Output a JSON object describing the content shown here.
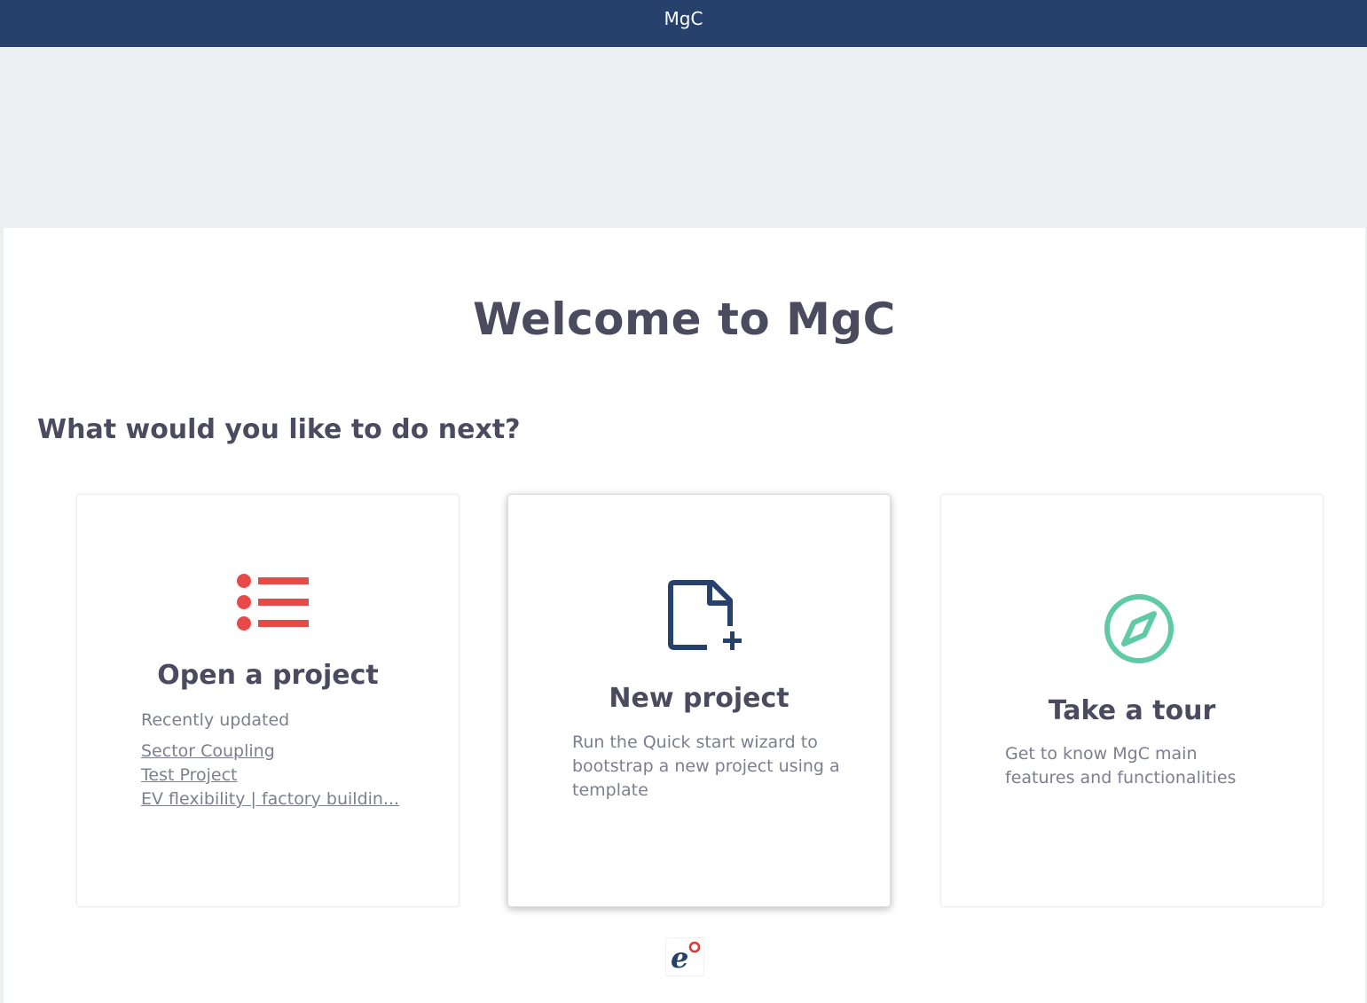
{
  "window": {
    "title": "MgC"
  },
  "main": {
    "welcome_title": "Welcome to MgC",
    "next_heading": "What would you like to do next?"
  },
  "cards": {
    "open_project": {
      "title": "Open a project",
      "recent_label": "Recently updated",
      "recent_projects": [
        "Sector Coupling",
        "Test Project",
        "EV flexibility | factory buildin..."
      ],
      "icon": "list-icon",
      "icon_color": "#e84a4a"
    },
    "new_project": {
      "title": "New project",
      "description": "Run the Quick start wizard to bootstrap a new project using a template",
      "icon": "new-file-icon",
      "icon_color": "#26416c"
    },
    "take_tour": {
      "title": "Take a tour",
      "description": "Get to know MgC main features and functionalities",
      "icon": "compass-icon",
      "icon_color": "#5fcaa5"
    }
  },
  "footer": {
    "logo": "e-logo"
  },
  "colors": {
    "titlebar": "#26416c",
    "background": "#edf0f3",
    "text_dark": "#4a4b5f",
    "text_muted": "#7d7f8e"
  }
}
